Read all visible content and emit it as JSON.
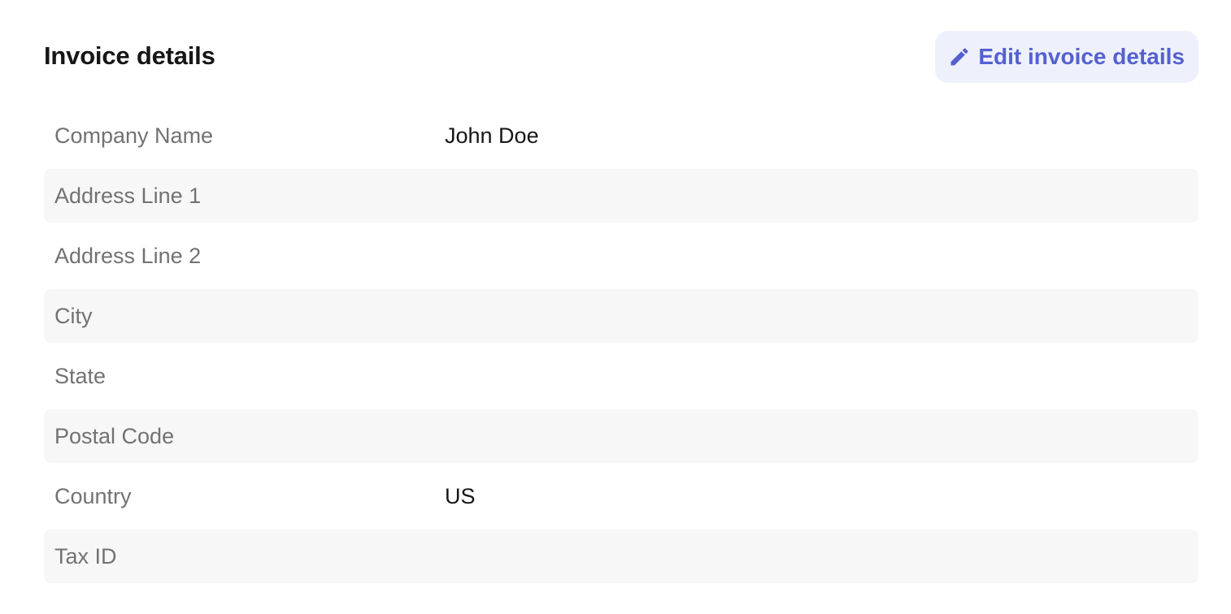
{
  "invoice": {
    "title": "Invoice details",
    "edit_button_label": "Edit invoice details",
    "edit_button_icon": "pencil-icon",
    "accent_color": "#5461cf",
    "fields": [
      {
        "label": "Company Name",
        "value": "John Doe"
      },
      {
        "label": "Address Line 1",
        "value": ""
      },
      {
        "label": "Address Line 2",
        "value": ""
      },
      {
        "label": "City",
        "value": ""
      },
      {
        "label": "State",
        "value": ""
      },
      {
        "label": "Postal Code",
        "value": ""
      },
      {
        "label": "Country",
        "value": "US"
      },
      {
        "label": "Tax ID",
        "value": ""
      }
    ]
  }
}
